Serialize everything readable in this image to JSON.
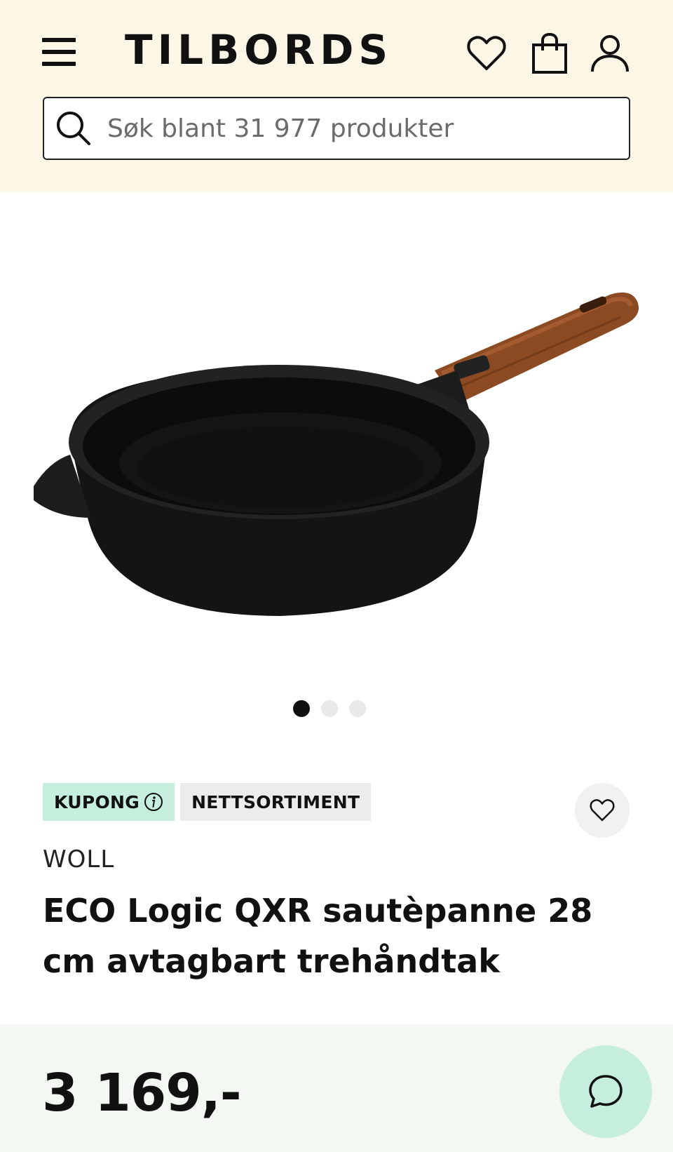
{
  "header": {
    "logo": "TILBORDS",
    "icons": [
      "menu-icon",
      "heart-icon",
      "shopping-bag-icon",
      "user-icon"
    ],
    "search": {
      "placeholder": "Søk blant 31 977 produkter",
      "value": ""
    },
    "background": "#fcf6e6"
  },
  "gallery": {
    "image": "sauté pan with wooden handle",
    "dots_total": 3,
    "active_dot": 1
  },
  "product": {
    "badges": [
      {
        "label": "KUPONG",
        "color": "#c5eedd",
        "icon": "info-icon"
      },
      {
        "label": "NETTSORTIMENT",
        "color": "#ececec"
      }
    ],
    "brand": "WOLL",
    "title": "ECO Logic QXR sautèpanne 28 cm avtagbart trehåndtak",
    "favorite_icon": "heart-icon"
  },
  "price_bar": {
    "price": "3 169,-",
    "chat_icon": "chat-bubble-icon",
    "background": "#f3f8f3",
    "chat_color": "#c5eedd"
  }
}
